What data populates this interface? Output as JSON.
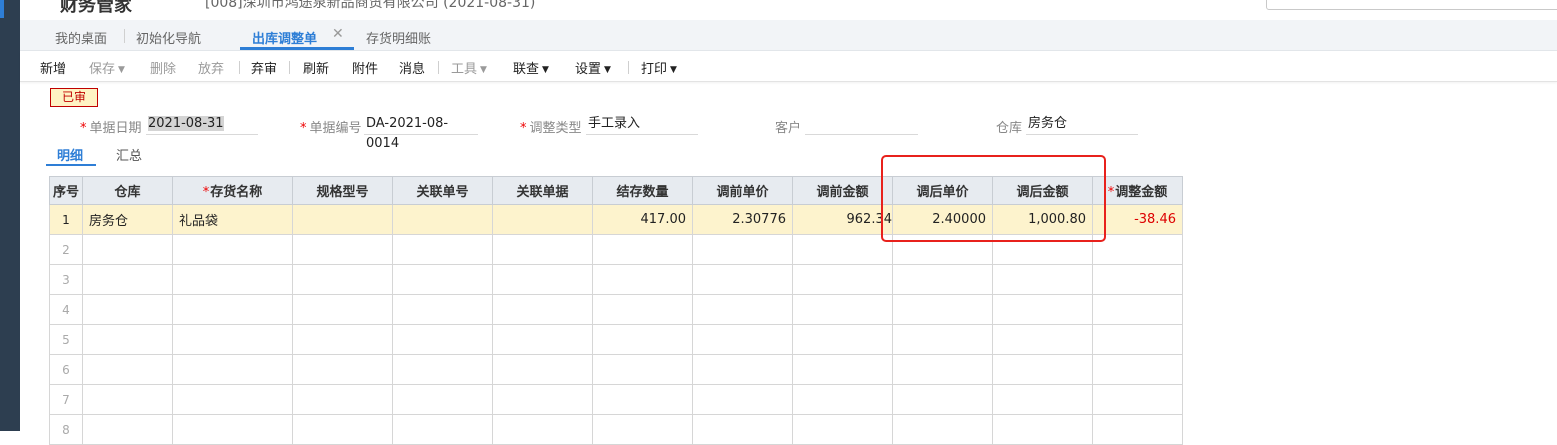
{
  "app": {
    "name": "财务管家",
    "company": "[008]深圳市鸿途泉新品商贸有限公司 (2021-08-31)"
  },
  "tabs": [
    {
      "label": "我的桌面"
    },
    {
      "label": "初始化导航"
    },
    {
      "label": "出库调整单"
    },
    {
      "label": "存货明细账"
    }
  ],
  "toolbar": {
    "new": "新增",
    "save": "保存",
    "delete": "删除",
    "discard": "放弃",
    "unaudit": "弃审",
    "refresh": "刷新",
    "attach": "附件",
    "message": "消息",
    "tools": "工具",
    "query": "联查",
    "settings": "设置",
    "print": "打印"
  },
  "status": "已审",
  "form": {
    "date_label": "单据日期",
    "date_value": "2021-08-31",
    "number_label": "单据编号",
    "number_value": "DA-2021-08-0014",
    "type_label": "调整类型",
    "type_value": "手工录入",
    "customer_label": "客户",
    "customer_value": "",
    "warehouse_label": "仓库",
    "warehouse_value": "房务仓"
  },
  "subtabs": {
    "detail": "明细",
    "summary": "汇总"
  },
  "table": {
    "headers": [
      "序号",
      "仓库",
      "存货名称",
      "规格型号",
      "关联单号",
      "关联单据",
      "结存数量",
      "调前单价",
      "调前金额",
      "调后单价",
      "调后金额",
      "调整金额"
    ],
    "row1": {
      "seq": "1",
      "warehouse": "房务仓",
      "item": "礼品袋",
      "spec": "",
      "ref_no": "",
      "ref_doc": "",
      "qty": "417.00",
      "unit_before": "2.30776",
      "amt_before": "962.34",
      "unit_after": "2.40000",
      "amt_after": "1,000.80",
      "adjust": "-38.46"
    },
    "empty_rows": [
      "2",
      "3",
      "4",
      "5",
      "6",
      "7",
      "8"
    ]
  },
  "colors": {
    "accent": "#2e7ed6",
    "highlight_row": "#fdf3cd",
    "negative": "#dd0000",
    "annotation": "#e8211c"
  }
}
